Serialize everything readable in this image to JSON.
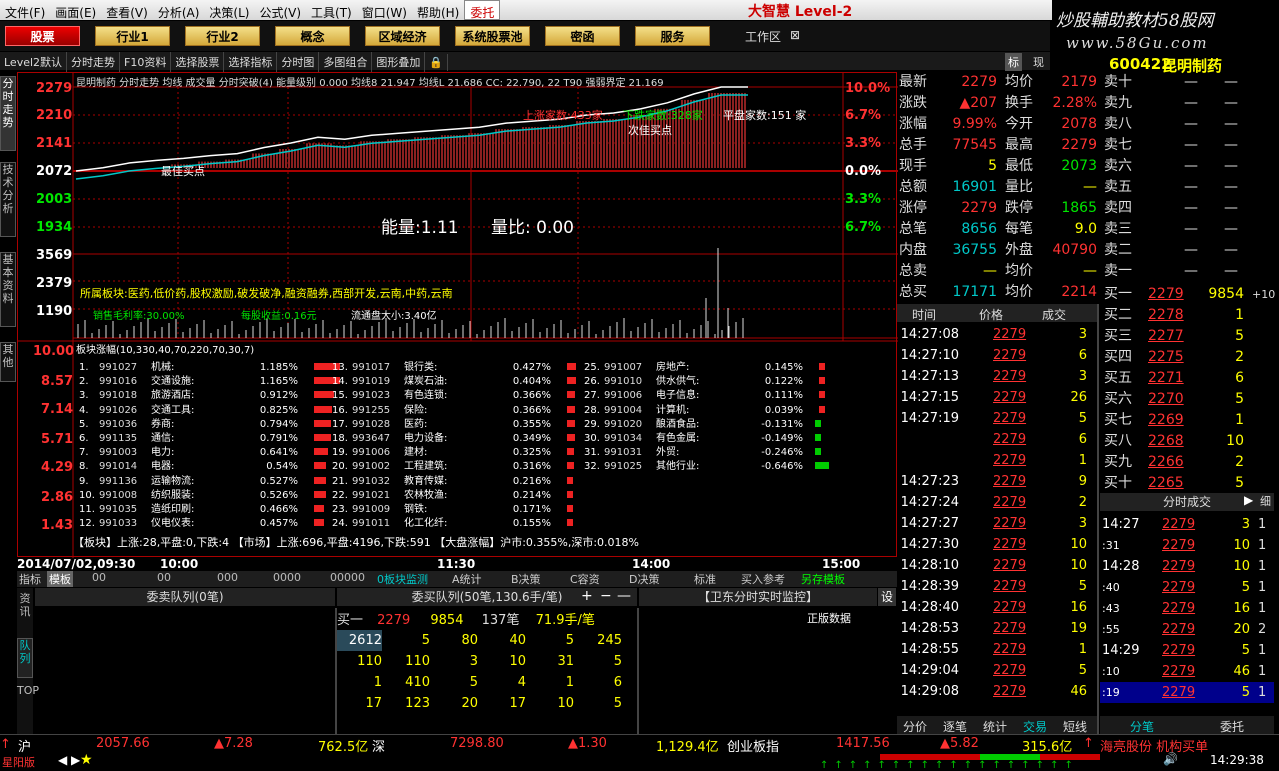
{
  "menu": [
    "文件(F)",
    "画面(E)",
    "查看(V)",
    "分析(A)",
    "决策(L)",
    "公式(V)",
    "工具(T)",
    "窗口(W)",
    "帮助(H)",
    "委托"
  ],
  "brand": "大智慧 Level-2",
  "watermark": "炒股輔助教材58股网",
  "watermark_url": "www.58Gu.com",
  "main_buttons": [
    "股票",
    "行业1",
    "行业2",
    "概念",
    "区域经济",
    "系统股票池",
    "密函",
    "服务"
  ],
  "workspace": "工作区",
  "toolbar": [
    "Level2默认",
    "分时走势",
    "F10资料",
    "选择股票",
    "选择指标",
    "分时图",
    "多图组合",
    "图形叠加"
  ],
  "toolbar_right": [
    "标",
    "现"
  ],
  "left_tabs": [
    "分时走势",
    "技术分析",
    "基本资料",
    "其他"
  ],
  "chart_header": "昆明制药 分时走势 均线 成交量 分时突破(4) 能量级别 0.000 均线8 21.947 均线L 21.686 CC: 22.790, 22 T90 强弱界定 21.169",
  "price_labels_left": [
    "2279",
    "2210",
    "2141",
    "2072",
    "2003",
    "1934",
    "3569",
    "2379",
    "1190"
  ],
  "pct_labels_right": [
    "10.0%",
    "6.7%",
    "3.3%",
    "0.0%",
    "3.3%",
    "6.7%"
  ],
  "chart_annot": {
    "up_count": "上涨家数:433家",
    "down_count": "下跌家数:328家",
    "flat_count": "平盘家数:151 家",
    "best_buy": "最佳买点",
    "second_buy": "次佳买点",
    "energy": "能量:1.11",
    "vol_ratio": "量比: 0.00"
  },
  "sector_info": "所属板块:医药,低价药,股权激励,破发破净,融资融券,西部开发,云南,中药,云南",
  "fin_info": [
    "销售毛利率:30.00%",
    "每股收益:0.16元",
    "流通盘大小:3.40亿"
  ],
  "chart_data": {
    "type": "line",
    "series": [
      {
        "name": "分时价格",
        "values": [
          2072,
          2080,
          2092,
          2098,
          2103,
          2110,
          2115,
          2130,
          2141,
          2155,
          2150,
          2160,
          2165,
          2170,
          2175,
          2180,
          2190,
          2195,
          2200,
          2210,
          2215,
          2225,
          2240,
          2262,
          2279,
          2279
        ]
      }
    ],
    "ylim": [
      1865,
      2279
    ]
  },
  "sector_panel_title": "板块涨幅(10,330,40,70,220,70,30,7)",
  "sectors": [
    [
      "1.",
      "991027",
      "机械:",
      "1.185%"
    ],
    [
      "2.",
      "991016",
      "交通设施:",
      "1.165%"
    ],
    [
      "3.",
      "991018",
      "旅游酒店:",
      "0.912%"
    ],
    [
      "4.",
      "991026",
      "交通工具:",
      "0.825%"
    ],
    [
      "5.",
      "991036",
      "券商:",
      "0.794%"
    ],
    [
      "6.",
      "991135",
      "通信:",
      "0.791%"
    ],
    [
      "7.",
      "991003",
      "电力:",
      "0.641%"
    ],
    [
      "8.",
      "991014",
      "电器:",
      "0.54%"
    ],
    [
      "9.",
      "991136",
      "运输物流:",
      "0.527%"
    ],
    [
      "10.",
      "991008",
      "纺织服装:",
      "0.526%"
    ],
    [
      "11.",
      "991035",
      "造纸印刷:",
      "0.466%"
    ],
    [
      "12.",
      "991033",
      "仪电仪表:",
      "0.457%"
    ],
    [
      "13.",
      "991017",
      "银行类:",
      "0.427%"
    ],
    [
      "14.",
      "991019",
      "煤炭石油:",
      "0.404%"
    ],
    [
      "15.",
      "991023",
      "有色连锁:",
      "0.366%"
    ],
    [
      "16.",
      "991255",
      "保险:",
      "0.366%"
    ],
    [
      "17.",
      "991028",
      "医药:",
      "0.355%"
    ],
    [
      "18.",
      "993647",
      "电力设备:",
      "0.349%"
    ],
    [
      "19.",
      "991006",
      "建材:",
      "0.325%"
    ],
    [
      "20.",
      "991002",
      "工程建筑:",
      "0.316%"
    ],
    [
      "21.",
      "991032",
      "教育传媒:",
      "0.216%"
    ],
    [
      "22.",
      "991021",
      "农林牧渔:",
      "0.214%"
    ],
    [
      "23.",
      "991009",
      "钢铁:",
      "0.171%"
    ],
    [
      "24.",
      "991011",
      "化工化纤:",
      "0.155%"
    ],
    [
      "25.",
      "991007",
      "房地产:",
      "0.145%"
    ],
    [
      "26.",
      "991010",
      "供水供气:",
      "0.122%"
    ],
    [
      "27.",
      "991006",
      "电子信息:",
      "0.111%"
    ],
    [
      "28.",
      "991004",
      "计算机:",
      "0.039%"
    ],
    [
      "29.",
      "991020",
      "酿酒食品:",
      "-0.131%"
    ],
    [
      "30.",
      "991034",
      "有色金属:",
      "-0.149%"
    ],
    [
      "31.",
      "991031",
      "外贸:",
      "-0.246%"
    ],
    [
      "32.",
      "991025",
      "其他行业:",
      "-0.646%"
    ]
  ],
  "market_line": "【板块】上涨:28,平盘:0,下跌:4 【市场】上涨:696,平盘:4196,下跌:591 【大盘涨幅】沪市:0.355%,深市:0.018%",
  "time_axis": [
    "2014/07/02,09:30",
    "10:00",
    "11:30",
    "14:00",
    "15:00"
  ],
  "bottom_tabs": [
    "指标",
    "模板",
    "0板块监测",
    "A统计",
    "B决策",
    "C容资",
    "D决策",
    "标准",
    "买入参考",
    "另存模板"
  ],
  "queue": {
    "sell_title": "委卖队列(0笔)",
    "buy_title": "委买队列(50笔,130.6手/笔)",
    "right_title": "【卫东分时实时监控】",
    "right_sub": "正版数据",
    "buy1": "买一",
    "buy_price": "2279",
    "buy_qty": "9854",
    "buy_cnt": "137笔",
    "buy_avg": "71.9手/笔",
    "rows": [
      [
        "2612",
        "5",
        "80",
        "40",
        "5",
        "245"
      ],
      [
        "110",
        "110",
        "3",
        "10",
        "31",
        "5"
      ],
      [
        "1",
        "410",
        "5",
        "4",
        "1",
        "6"
      ],
      [
        "17",
        "123",
        "20",
        "17",
        "10",
        "5"
      ]
    ],
    "side_tabs": [
      "资讯",
      "队列",
      "TOP"
    ]
  },
  "quote": {
    "code": "600422",
    "name": "昆明制药",
    "rows": [
      [
        "最新",
        "2279",
        "均价",
        "2179"
      ],
      [
        "涨跌",
        "▲207",
        "换手",
        "2.28%"
      ],
      [
        "涨幅",
        "9.99%",
        "今开",
        "2078"
      ],
      [
        "总手",
        "77545",
        "最高",
        "2279"
      ],
      [
        "现手",
        "5",
        "最低",
        "2073"
      ],
      [
        "总额",
        "16901",
        "量比",
        "—"
      ],
      [
        "涨停",
        "2279",
        "跌停",
        "1865"
      ],
      [
        "总笔",
        "8656",
        "每笔",
        "9.0"
      ],
      [
        "内盘",
        "36755",
        "外盘",
        "40790"
      ],
      [
        "总卖",
        "—",
        "均价",
        "—"
      ],
      [
        "总买",
        "17171",
        "均价",
        "2214"
      ]
    ],
    "asks": [
      "卖十",
      "卖九",
      "卖八",
      "卖七",
      "卖六",
      "卖五",
      "卖四",
      "卖三",
      "卖二",
      "卖一"
    ],
    "bids": [
      [
        "买一",
        "2279",
        "9854",
        "+10"
      ],
      [
        "买二",
        "2278",
        "1",
        ""
      ],
      [
        "买三",
        "2277",
        "5",
        ""
      ],
      [
        "买四",
        "2275",
        "2",
        ""
      ],
      [
        "买五",
        "2271",
        "6",
        ""
      ],
      [
        "买六",
        "2270",
        "5",
        ""
      ],
      [
        "买七",
        "2269",
        "1",
        ""
      ],
      [
        "买八",
        "2268",
        "10",
        ""
      ],
      [
        "买九",
        "2266",
        "2",
        ""
      ],
      [
        "买十",
        "2265",
        "5",
        ""
      ]
    ]
  },
  "ticks_header": [
    "时间",
    "价格",
    "成交"
  ],
  "ticks": [
    [
      "14:27:08",
      "2279",
      "3"
    ],
    [
      "14:27:10",
      "2279",
      "6"
    ],
    [
      "14:27:13",
      "2279",
      "3"
    ],
    [
      "14:27:15",
      "2279",
      "26"
    ],
    [
      "14:27:19",
      "2279",
      "5"
    ],
    [
      "",
      "2279",
      "6"
    ],
    [
      "",
      "2279",
      "1"
    ],
    [
      "14:27:23",
      "2279",
      "9"
    ],
    [
      "14:27:24",
      "2279",
      "2"
    ],
    [
      "14:27:27",
      "2279",
      "3"
    ],
    [
      "14:27:30",
      "2279",
      "10"
    ],
    [
      "14:28:10",
      "2279",
      "10"
    ],
    [
      "14:28:39",
      "2279",
      "5"
    ],
    [
      "14:28:40",
      "2279",
      "16"
    ],
    [
      "14:28:53",
      "2279",
      "19"
    ],
    [
      "14:28:55",
      "2279",
      "1"
    ],
    [
      "14:29:04",
      "2279",
      "5"
    ],
    [
      "14:29:08",
      "2279",
      "46"
    ]
  ],
  "min_trades_title": "分时成交",
  "min_trades": [
    [
      "14:27",
      "2279",
      "3",
      "1"
    ],
    [
      ":31",
      "2279",
      "10",
      "1"
    ],
    [
      "14:28",
      "2279",
      "10",
      "1"
    ],
    [
      ":40",
      "2279",
      "5",
      "1"
    ],
    [
      ":43",
      "2279",
      "16",
      "1"
    ],
    [
      ":55",
      "2279",
      "20",
      "2"
    ],
    [
      "14:29",
      "2279",
      "5",
      "1"
    ],
    [
      ":10",
      "2279",
      "46",
      "1"
    ],
    [
      ":19",
      "2279",
      "5",
      "1"
    ]
  ],
  "ticks_tabs": [
    "分价",
    "逐笔",
    "统计",
    "交易",
    "短线"
  ],
  "right_tabs": [
    "分笔",
    "委托"
  ],
  "status": {
    "sh_label": "沪",
    "sh_val": "2057.66",
    "sh_chg": "▲7.28",
    "sh_amt": "762.5亿",
    "sz_label": "深",
    "sz_val": "7298.80",
    "sz_chg": "▲1.30",
    "sz_amt": "1,129.4亿",
    "cy_label": "创业板指",
    "cy_val": "1417.56",
    "cy_chg": "▲5.82",
    "cy_amt": "315.6亿",
    "news": "海亮股份 机构买单",
    "time": "14:29:38",
    "app": "星阳版"
  }
}
